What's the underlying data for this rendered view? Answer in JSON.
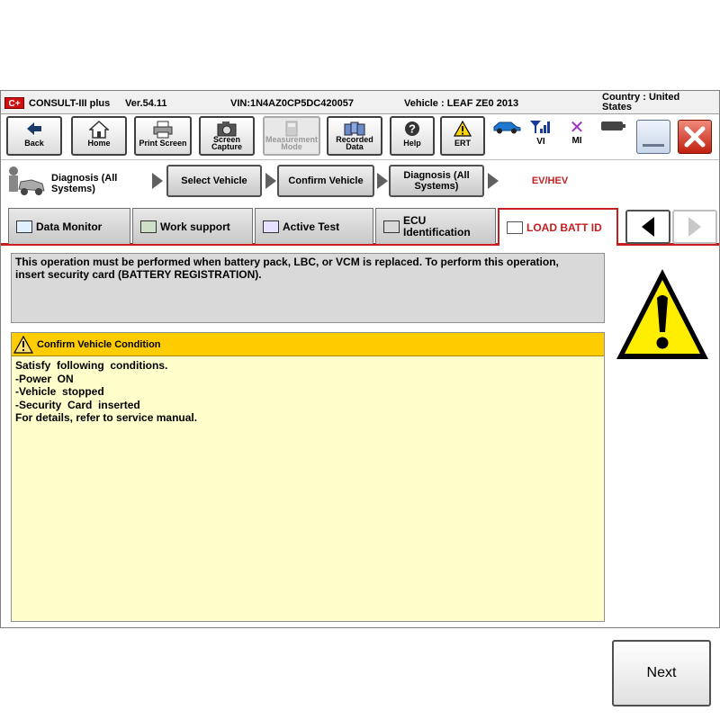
{
  "titlebar": {
    "logo": "C+",
    "app": "CONSULT-III plus",
    "version": "Ver.54.11",
    "vin": "VIN:1N4AZ0CP5DC420057",
    "vehicle": "Vehicle : LEAF ZE0 2013",
    "country": "Country : United States"
  },
  "toolbar": {
    "back": "Back",
    "home": "Home",
    "print_screen": "Print Screen",
    "screen_capture_1": "Screen",
    "screen_capture_2": "Capture",
    "measurement_1": "Measurement",
    "measurement_2": "Mode",
    "recorded_1": "Recorded",
    "recorded_2": "Data",
    "help": "Help",
    "ert": "ERT",
    "vi": "VI",
    "mi": "MI"
  },
  "breadcrumb": {
    "first_1": "Diagnosis (All",
    "first_2": "Systems)",
    "select_vehicle": "Select Vehicle",
    "confirm_vehicle": "Confirm Vehicle",
    "diag_all_1": "Diagnosis (All",
    "diag_all_2": "Systems)",
    "ev_hev": "EV/HEV"
  },
  "tabs": {
    "data_monitor": "Data Monitor",
    "work_support": "Work support",
    "active_test": "Active Test",
    "ecu_1": "ECU",
    "ecu_2": "Identification",
    "load_batt_id": "LOAD BATT ID"
  },
  "message": {
    "line1": "This operation must be performed when battery pack, LBC, or VCM is replaced. To perform this operation,",
    "line2": "insert security card (BATTERY REGISTRATION)."
  },
  "condition": {
    "header": "Confirm Vehicle Condition",
    "lines": [
      "Satisfy  following  conditions.",
      "-Power  ON",
      "-Vehicle  stopped",
      "-Security  Card  inserted",
      "For details, refer to service manual."
    ]
  },
  "next_label": "Next",
  "colors": {
    "accent_red": "#c41e1e",
    "warning_yellow": "#ffcc00",
    "panel_yellow": "#ffffcc"
  }
}
